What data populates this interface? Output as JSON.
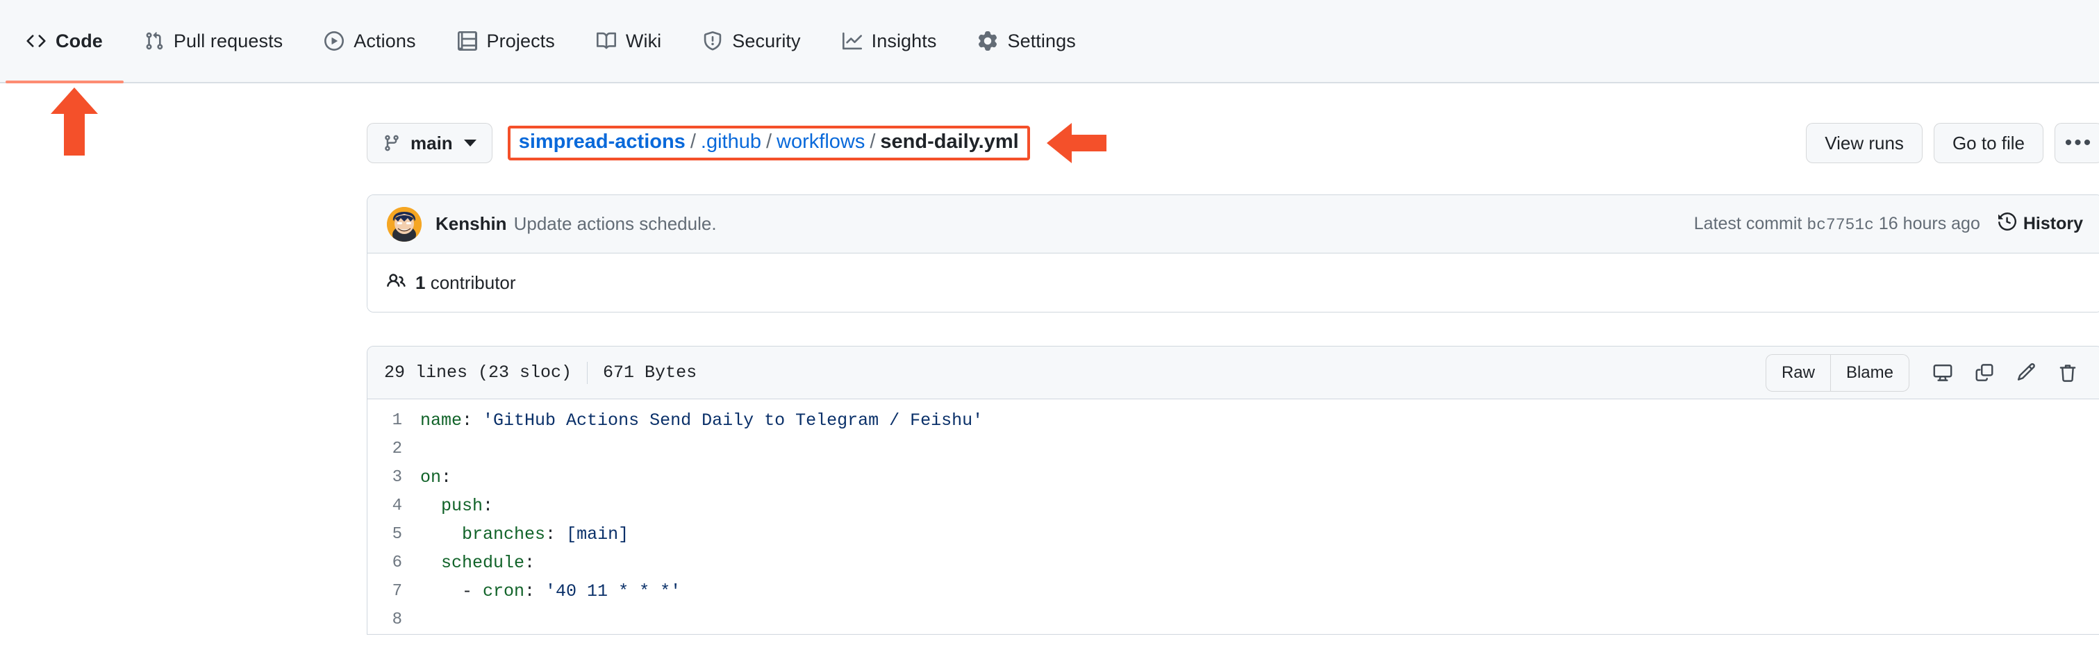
{
  "nav": {
    "items": [
      {
        "label": "Code",
        "icon": "code-icon",
        "selected": true
      },
      {
        "label": "Pull requests",
        "icon": "git-pull-request-icon",
        "selected": false
      },
      {
        "label": "Actions",
        "icon": "play-circle-icon",
        "selected": false
      },
      {
        "label": "Projects",
        "icon": "table-icon",
        "selected": false
      },
      {
        "label": "Wiki",
        "icon": "book-icon",
        "selected": false
      },
      {
        "label": "Security",
        "icon": "shield-icon",
        "selected": false
      },
      {
        "label": "Insights",
        "icon": "graph-icon",
        "selected": false
      },
      {
        "label": "Settings",
        "icon": "gear-icon",
        "selected": false
      }
    ],
    "active_underline_color": "#fd8c73"
  },
  "annotations": {
    "orange_color": "#f4502a",
    "teal_color": "#00a088",
    "arrow_up_code": "points-to-code-tab",
    "arrow_left_breadcrumb": "points-to-file-breadcrumb",
    "arrow_up_edit": "points-to-edit-pencil-icon"
  },
  "file_header": {
    "branch": "main",
    "breadcrumb": {
      "repo": "simpread-actions",
      "segments": [
        ".github",
        "workflows"
      ],
      "current": "send-daily.yml",
      "separator": "/"
    },
    "view_runs_label": "View runs",
    "go_to_file_label": "Go to file",
    "kebab_label": "•••"
  },
  "commit": {
    "author": "Kenshin",
    "message": "Update actions schedule.",
    "latest_commit_label": "Latest commit",
    "sha": "bc7751c",
    "time": "16 hours ago",
    "history_label": "History",
    "contributors_count": "1",
    "contributors_label": "contributor"
  },
  "blob": {
    "lines_label": "29 lines (23 sloc)",
    "size_label": "671 Bytes",
    "raw_label": "Raw",
    "blame_label": "Blame",
    "icons": [
      "desktop-download-icon",
      "copy-icon",
      "pencil-icon",
      "trash-icon"
    ]
  },
  "code": {
    "language": "yaml",
    "lines": [
      {
        "n": "1",
        "tokens": [
          {
            "t": "key",
            "v": "name"
          },
          {
            "t": "punct",
            "v": ": "
          },
          {
            "t": "str",
            "v": "'GitHub Actions Send Daily to Telegram / Feishu'"
          }
        ]
      },
      {
        "n": "2",
        "tokens": []
      },
      {
        "n": "3",
        "tokens": [
          {
            "t": "key",
            "v": "on"
          },
          {
            "t": "punct",
            "v": ":"
          }
        ]
      },
      {
        "n": "4",
        "tokens": [
          {
            "t": "punct",
            "v": "  "
          },
          {
            "t": "key",
            "v": "push"
          },
          {
            "t": "punct",
            "v": ":"
          }
        ]
      },
      {
        "n": "5",
        "tokens": [
          {
            "t": "punct",
            "v": "    "
          },
          {
            "t": "key",
            "v": "branches"
          },
          {
            "t": "punct",
            "v": ": "
          },
          {
            "t": "str",
            "v": "[main]"
          }
        ]
      },
      {
        "n": "6",
        "tokens": [
          {
            "t": "punct",
            "v": "  "
          },
          {
            "t": "key",
            "v": "schedule"
          },
          {
            "t": "punct",
            "v": ":"
          }
        ]
      },
      {
        "n": "7",
        "tokens": [
          {
            "t": "punct",
            "v": "    - "
          },
          {
            "t": "key",
            "v": "cron"
          },
          {
            "t": "punct",
            "v": ": "
          },
          {
            "t": "str",
            "v": "'40 11 * * *'"
          }
        ]
      },
      {
        "n": "8",
        "tokens": []
      }
    ]
  }
}
